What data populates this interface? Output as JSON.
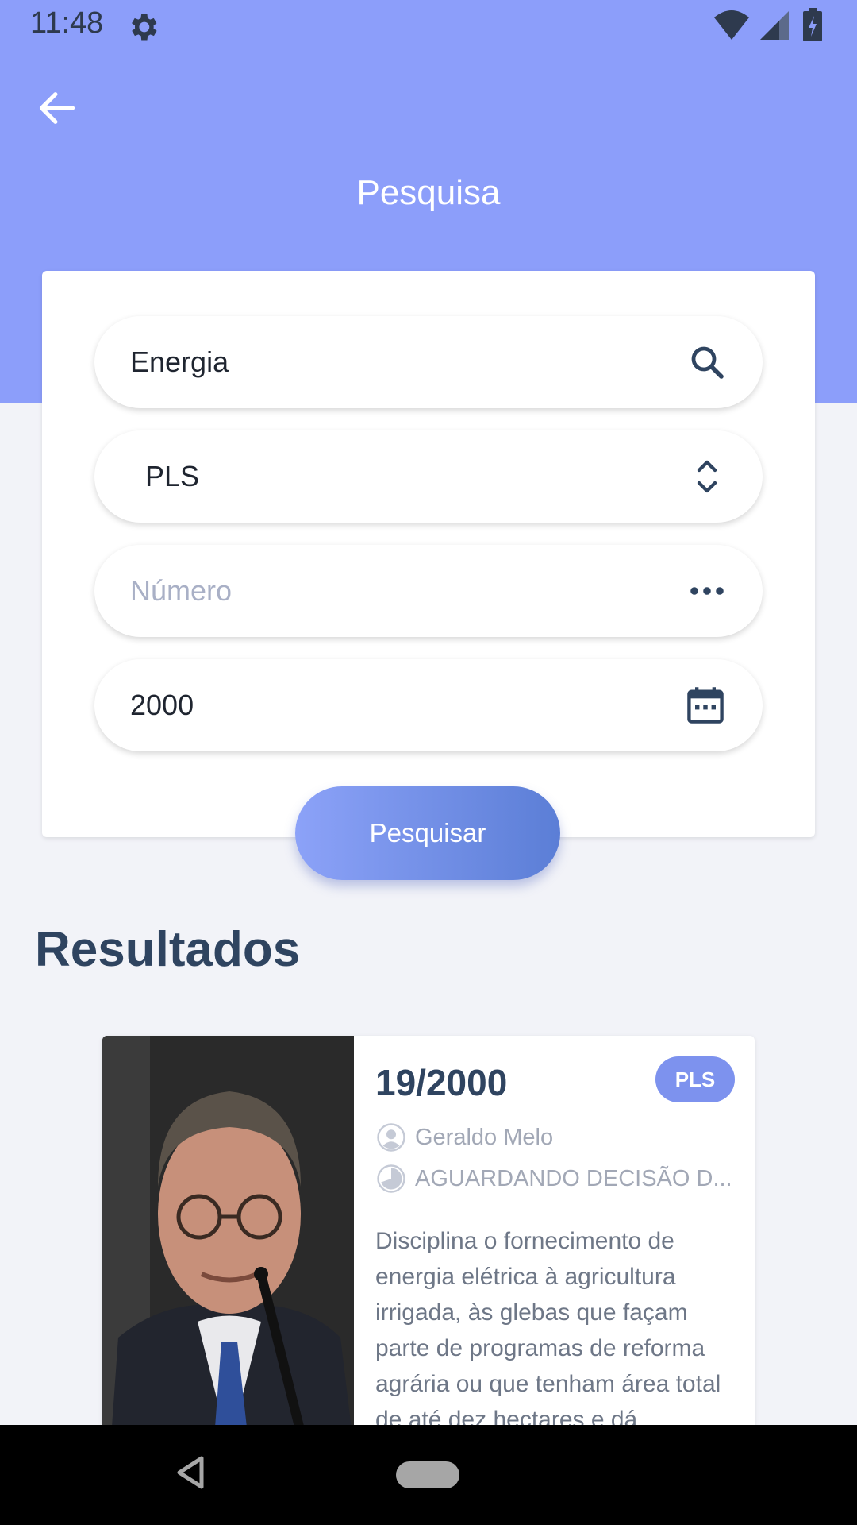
{
  "status_bar": {
    "time": "11:48"
  },
  "header": {
    "title": "Pesquisa"
  },
  "form": {
    "keyword_value": "Energia",
    "type_value": "PLS",
    "number_placeholder": "Número",
    "year_value": "2000",
    "submit_label": "Pesquisar"
  },
  "results": {
    "heading": "Resultados",
    "items": [
      {
        "number": "19/2000",
        "type": "PLS",
        "author": "Geraldo Melo",
        "status": "AGUARDANDO DECISÃO D...",
        "description": "Disciplina o fornecimento de energia elétrica à agricultura irrigada, às glebas que façam parte de programas de reforma agrária ou que tenham área total de até dez hectares e dá"
      }
    ]
  },
  "colors": {
    "header": "#8c9efa",
    "accent": "#7d92ee",
    "heading_text": "#2f4460",
    "background": "#f2f3f8"
  },
  "icons": [
    "settings-icon",
    "wifi-icon",
    "signal-icon",
    "battery-icon",
    "back-arrow-icon",
    "search-icon",
    "select-chevrons-icon",
    "more-dots-icon",
    "calendar-icon",
    "person-icon",
    "clock-icon",
    "nav-back-icon",
    "nav-home-icon"
  ]
}
